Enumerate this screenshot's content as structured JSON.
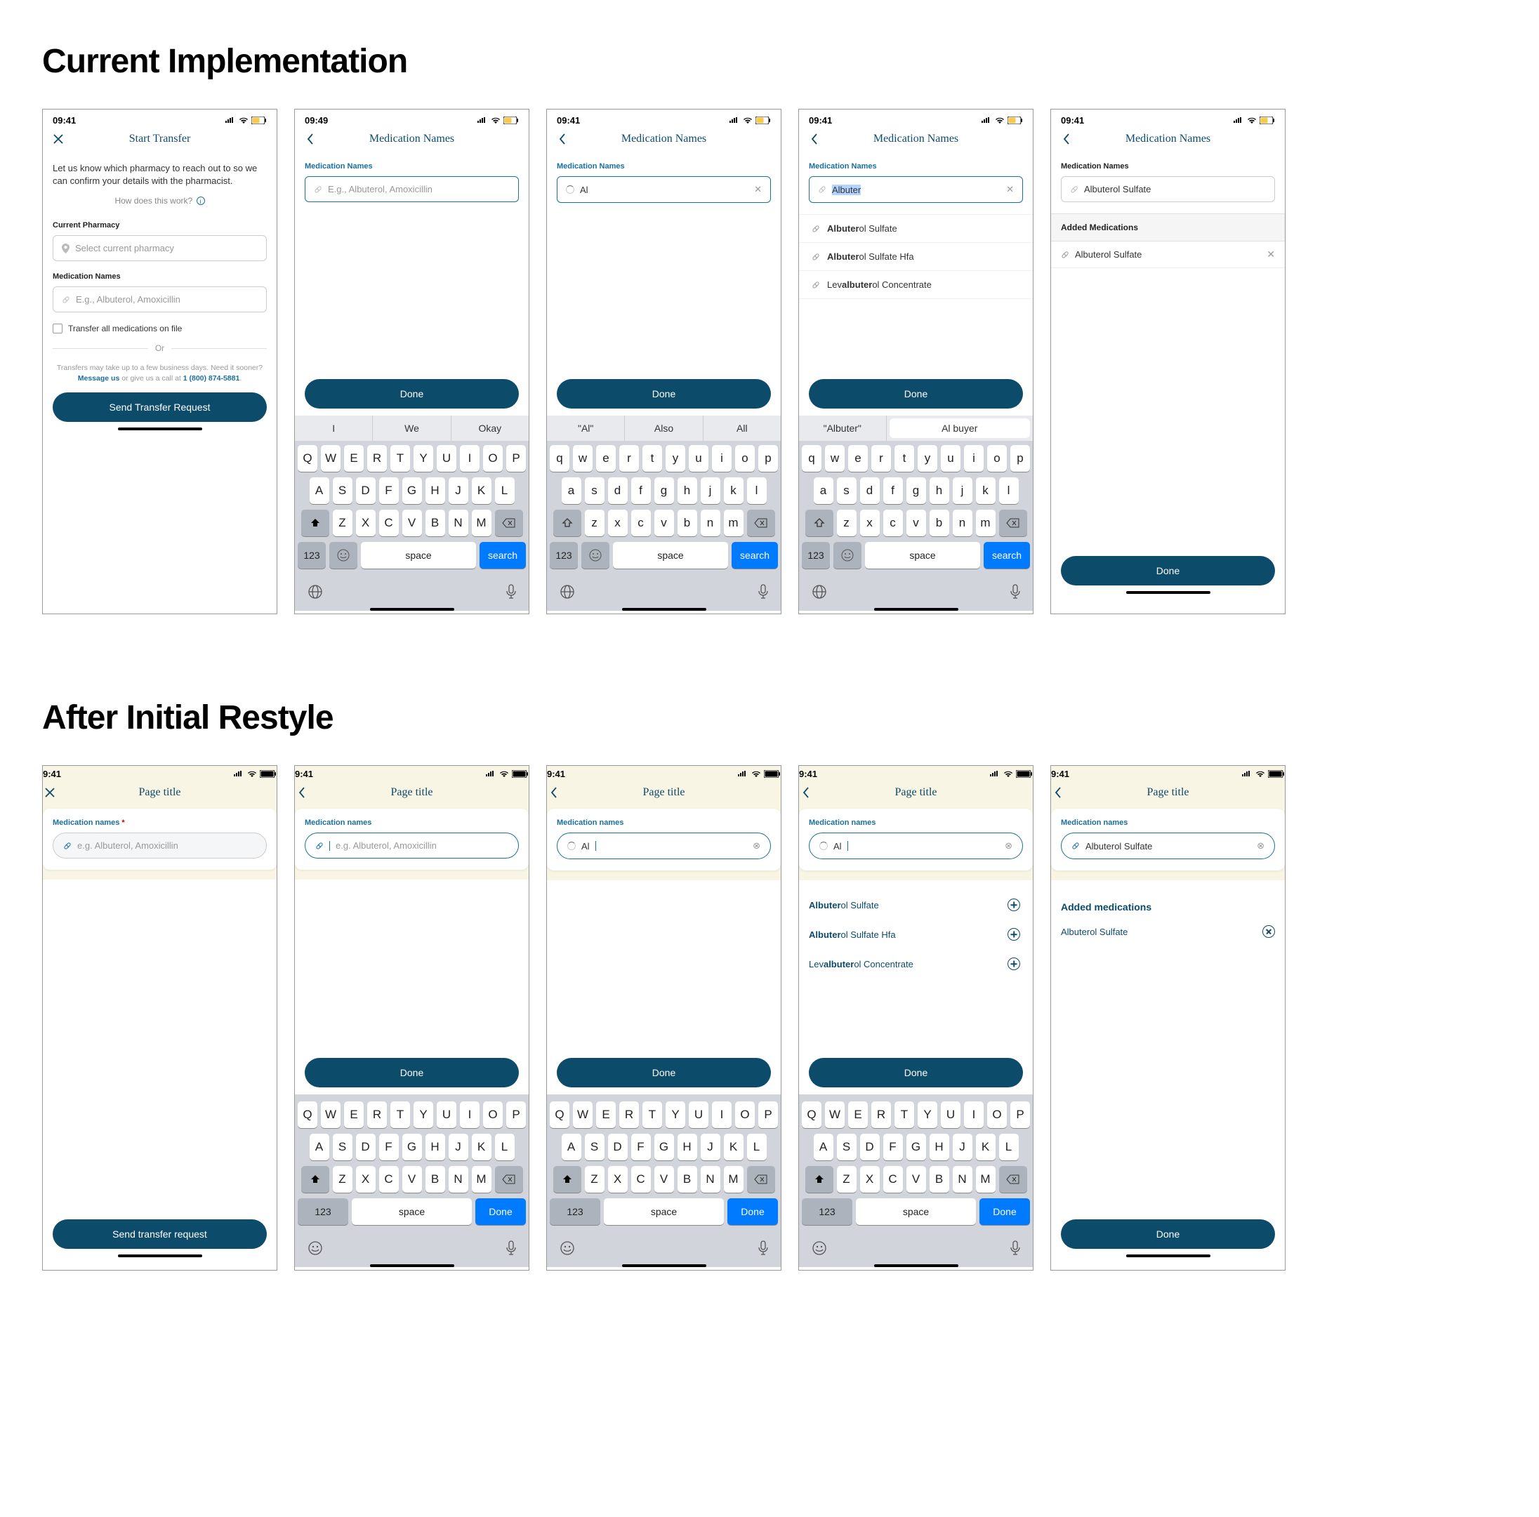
{
  "headings": {
    "current": "Current Implementation",
    "after": "After Initial Restyle"
  },
  "status": {
    "time": "09:41",
    "time_alt": "09:49",
    "time_b": "9:41"
  },
  "nav": {
    "start_transfer": "Start Transfer",
    "med_names": "Medication Names",
    "page_title": "Page title"
  },
  "screen1": {
    "intro": "Let us know which pharmacy to reach out to so we can confirm your details with the pharmacist.",
    "how": "How does this work?",
    "current_pharmacy": "Current Pharmacy",
    "pharmacy_placeholder": "Select current pharmacy",
    "med_names": "Medication Names",
    "med_placeholder": "E.g., Albuterol, Amoxicillin",
    "transfer_all": "Transfer all medications on file",
    "or": "Or",
    "fine_1": "Transfers may take up to a few business days. Need it sooner? ",
    "fine_msg": "Message us",
    "fine_2": " or give us a call at ",
    "fine_phone": "1 (800) 874-5881",
    "send": "Send Transfer Request"
  },
  "common": {
    "done": "Done",
    "med_names_label": "Medication Names",
    "med_names_label_lc": "Medication names",
    "placeholder": "E.g., Albuterol, Amoxicillin",
    "placeholder_lc": "e.g. Albuterol, Amoxicillin",
    "added_meds": "Added Medications",
    "added_meds_lc": "Added medications",
    "send_lc": "Send transfer request"
  },
  "typed": {
    "al": "Al",
    "albuter": "Albuter",
    "albuterol_sulfate": "Albuterol Sulfate"
  },
  "suggestions": [
    {
      "pre": "",
      "b": "Albuter",
      "post": "ol Sulfate"
    },
    {
      "pre": "",
      "b": "Albuter",
      "post": "ol Sulfate Hfa"
    },
    {
      "pre": "Lev",
      "b": "albuter",
      "post": "ol Concentrate"
    }
  ],
  "suggestions_re": [
    {
      "pre": "",
      "b": "Albuter",
      "post": "ol Sulfate"
    },
    {
      "pre": "",
      "b": "Albuter",
      "post": "ol Sulfate Hfa"
    },
    {
      "pre": "Lev",
      "b": "albuter",
      "post": "ol Concentrate"
    }
  ],
  "added": {
    "item": "Albuterol Sulfate"
  },
  "kb": {
    "row1": [
      "Q",
      "W",
      "E",
      "R",
      "T",
      "Y",
      "U",
      "I",
      "O",
      "P"
    ],
    "row2": [
      "A",
      "S",
      "D",
      "F",
      "G",
      "H",
      "J",
      "K",
      "L"
    ],
    "row3": [
      "Z",
      "X",
      "C",
      "V",
      "B",
      "N",
      "M"
    ],
    "space": "space",
    "search": "search",
    "done": "Done",
    "num": "123",
    "pred_a": [
      "I",
      "We",
      "Okay"
    ],
    "pred_b": [
      "Al",
      "Also",
      "All"
    ],
    "pred_c": [
      "Albuter",
      "Al buyer"
    ]
  }
}
